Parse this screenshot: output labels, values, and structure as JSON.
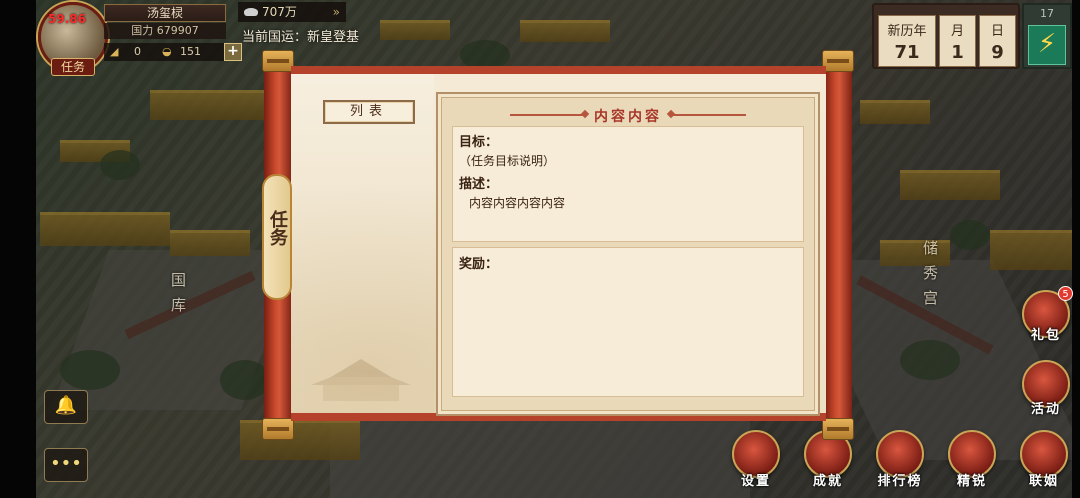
{
  "hud": {
    "fps": "59.86",
    "task_tag": "任务",
    "player_name": "汤玺棂",
    "power": "国力 679907",
    "res1": "0",
    "res2": "151",
    "plus": "+",
    "silver": "707万",
    "silver_arrows": "»",
    "guoyun": "当前国运：新皇登基"
  },
  "calendar": {
    "era_label": "新历年",
    "month_label": "月",
    "day_label": "日",
    "year": "71",
    "month": "1",
    "day": "9",
    "energy_count": "17"
  },
  "map_labels": {
    "treasury": "国库",
    "palace": "储秀宫"
  },
  "right_buttons": {
    "gift": "礼包",
    "gift_badge": "5",
    "activity": "活动",
    "settings": "设置",
    "achievement": "成就",
    "ranking": "排行榜",
    "elite": "精锐",
    "alliance": "联姻"
  },
  "panel": {
    "side_tab": "任务",
    "list_tab": "列表",
    "content_title": "内容内容",
    "goal_label": "目标：",
    "goal_text": "（任务目标说明）",
    "desc_label": "描述：",
    "desc_text": "内容内容内容内容",
    "reward_label": "奖励："
  },
  "colors": {
    "scroll_red": "#b5422a",
    "paper": "#f4ead6",
    "title_red": "#a8362a"
  }
}
